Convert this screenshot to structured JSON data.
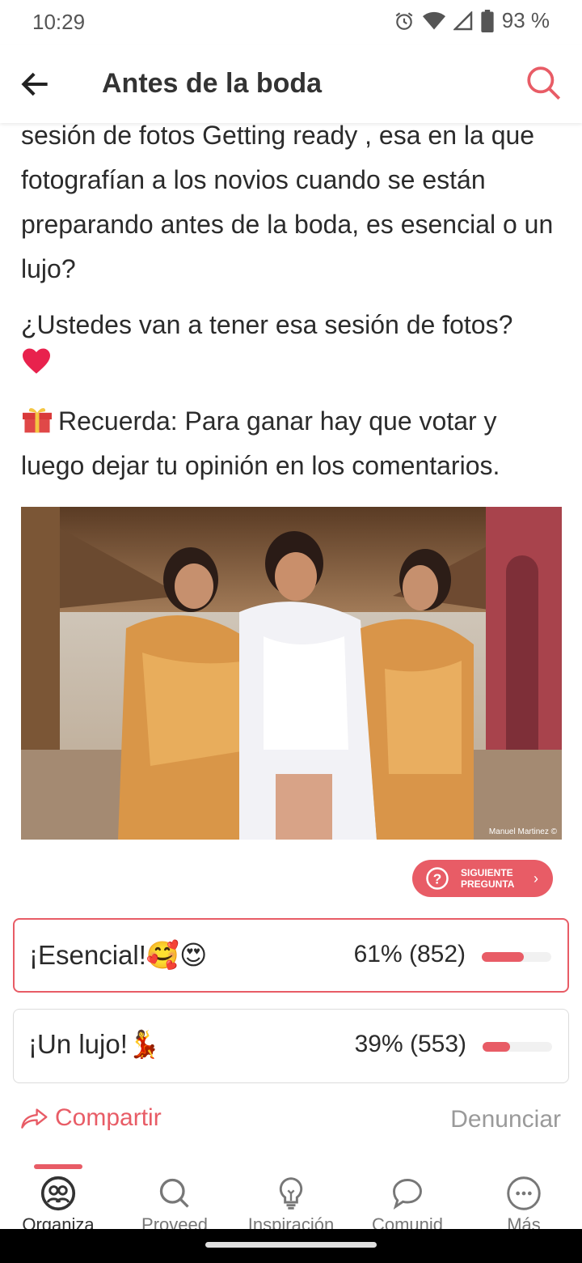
{
  "status_bar": {
    "time": "10:29",
    "battery": "93 %"
  },
  "header": {
    "title": "Antes de la boda"
  },
  "post": {
    "paragraph1": "sesión de fotos Getting ready , esa en la que fotografían a los novios cuando se están preparando antes de la boda, es esencial o un lujo?",
    "paragraph2": "¿Ustedes van a tener esa sesión de fotos?",
    "paragraph3": "Recuerda: Para ganar hay que votar y luego dejar tu opinión en los comentarios.",
    "photo_credit": "Manuel Martinez ©"
  },
  "next_question": {
    "label": "SIGUIENTE PREGUNTA"
  },
  "poll": {
    "options": [
      {
        "label": "¡Esencial!🥰😍",
        "result": "61% (852)",
        "percent": 61,
        "selected": true
      },
      {
        "label": "¡Un lujo!💃",
        "result": "39% (553)",
        "percent": 39,
        "selected": false
      }
    ]
  },
  "actions": {
    "share": "Compartir",
    "report": "Denunciar"
  },
  "bottom_nav": {
    "items": [
      {
        "label": "Organiza",
        "icon": "organize-icon"
      },
      {
        "label": "Proveed",
        "icon": "search-icon"
      },
      {
        "label": "Inspiración",
        "icon": "lightbulb-icon"
      },
      {
        "label": "Comunid",
        "icon": "chat-bubble-icon"
      },
      {
        "label": "Más",
        "icon": "more-icon"
      }
    ]
  },
  "colors": {
    "accent": "#e85c66",
    "text": "#2b2b2b",
    "muted": "#9a9a9a"
  }
}
